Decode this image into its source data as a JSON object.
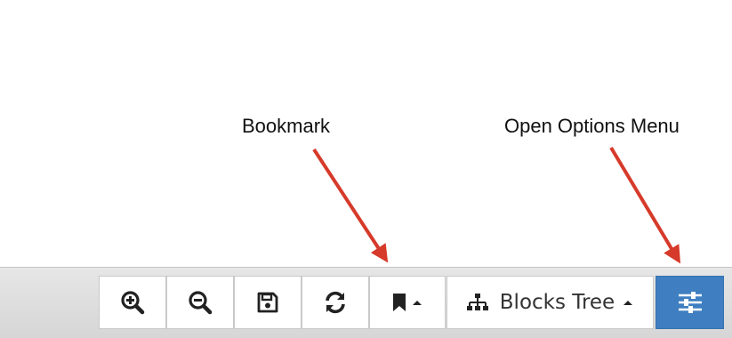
{
  "annotations": {
    "bookmark": "Bookmark",
    "open_options_menu": "Open Options Menu"
  },
  "toolbar": {
    "blocks_tree_label": "Blocks Tree",
    "buttons": [
      {
        "icon": "zoom-in-icon"
      },
      {
        "icon": "zoom-out-icon"
      },
      {
        "icon": "save-icon"
      },
      {
        "icon": "refresh-icon"
      },
      {
        "icon": "bookmark-icon"
      },
      {
        "icon": "sitemap-icon"
      },
      {
        "icon": "sliders-icon"
      }
    ]
  },
  "colors": {
    "arrow": "#d63a2a",
    "options_button": "#3f7fc1",
    "toolbar_bg": "#dcdcdc"
  }
}
